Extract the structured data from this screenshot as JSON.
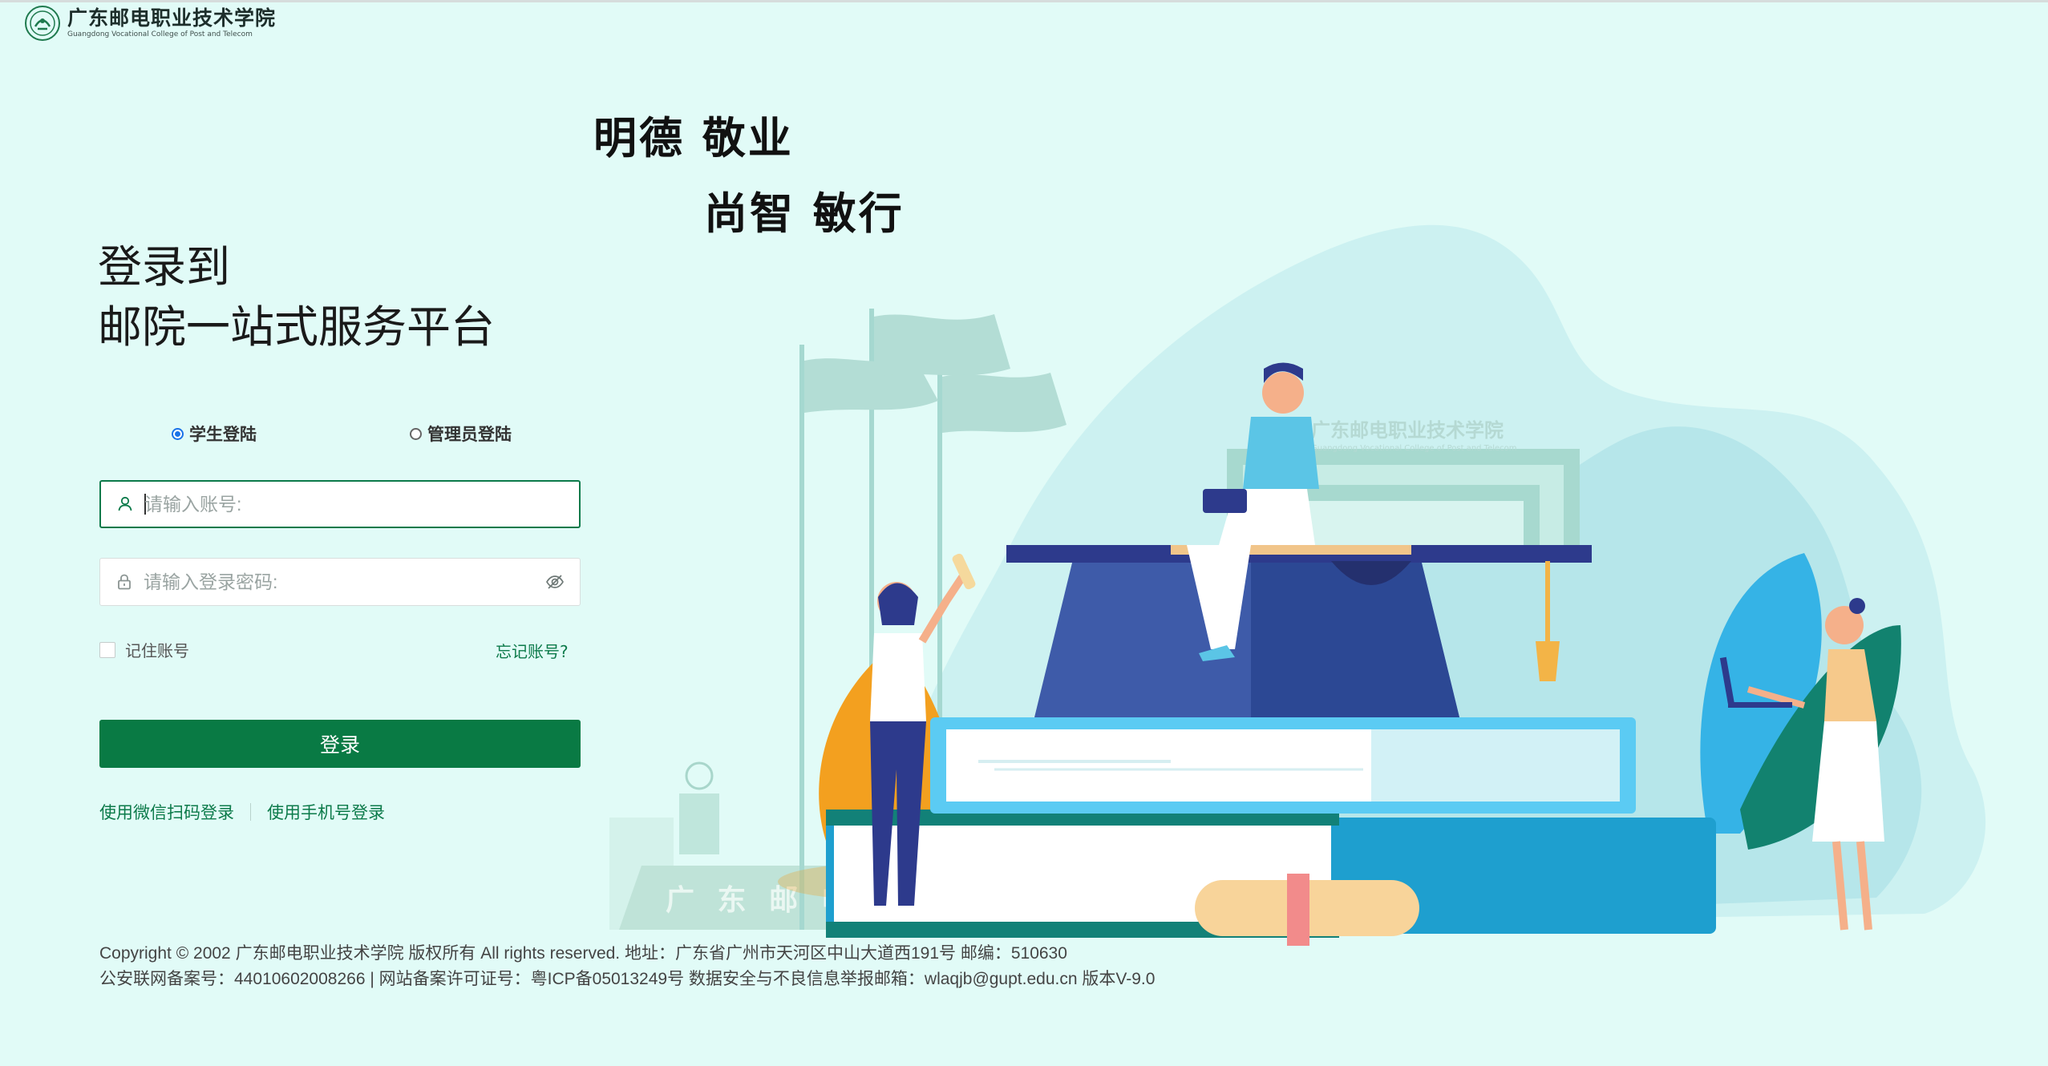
{
  "header": {
    "logo_name_cn": "广东邮电职业技术学院",
    "logo_name_en": "Guangdong Vocational College of Post and Telecom"
  },
  "motto": {
    "line1": "明德  敬业",
    "line2": "尚智  敏行"
  },
  "title": {
    "line1": "登录到",
    "line2": "邮院一站式服务平台"
  },
  "login_type": {
    "options": [
      {
        "label": "学生登陆",
        "selected": true
      },
      {
        "label": "管理员登陆",
        "selected": false
      }
    ]
  },
  "form": {
    "account_placeholder": "请输入账号:",
    "account_value": "",
    "password_placeholder": "请输入登录密码:",
    "password_value": "",
    "remember_label": "记住账号",
    "remember_checked": false,
    "forgot_label": "忘记账号?",
    "submit_label": "登录"
  },
  "alt_login": {
    "wechat_label": "使用微信扫码登录",
    "phone_label": "使用手机号登录"
  },
  "illustration": {
    "building_sign": "广东邮电职业技术学院",
    "building_sign_en": "Guangdong Vocational College of Post and Telecom",
    "stone_text": "广 东 邮 电"
  },
  "footer": {
    "line1": "Copyright © 2002 广东邮电职业技术学院 版权所有 All rights reserved. 地址：广东省广州市天河区中山大道西191号  邮编：510630",
    "line2": "公安联网备案号：44010602008266 | 网站备案许可证号：粤ICP备05013249号 数据安全与不良信息举报邮箱：wlaqjb@gupt.edu.cn  版本V-9.0"
  },
  "colors": {
    "background": "#e1fbf7",
    "primary": "#097a44",
    "link": "#0c7a4a",
    "radio_selected": "#1a73e8"
  },
  "icons": {
    "account": "user-icon",
    "password": "lock-icon",
    "visibility": "eye-off-icon",
    "logo": "college-emblem-icon"
  }
}
